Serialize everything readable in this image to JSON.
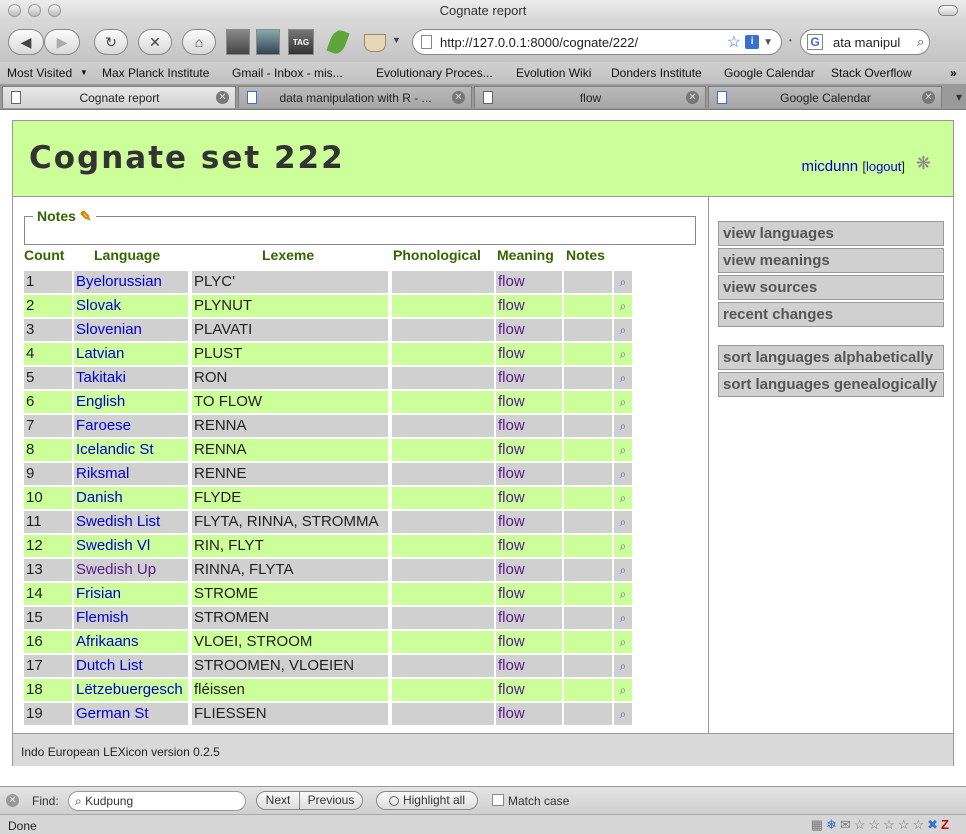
{
  "window": {
    "title": "Cognate report"
  },
  "toolbar": {
    "url": "http://127.0.0.1:8000/cognate/222/",
    "search_value": "ata manipul",
    "search_engine_glyph": "G",
    "tag_label": "TAG"
  },
  "bookmarks": [
    "Most Visited",
    "Max Planck Institute",
    "Gmail - Inbox - mis...",
    "Evolutionary Proces...",
    "Evolution Wiki",
    "Donders Institute",
    "Google Calendar",
    "Stack Overflow"
  ],
  "tabs": [
    {
      "label": "Cognate report",
      "active": true
    },
    {
      "label": "data manipulation with R - ...",
      "active": false
    },
    {
      "label": "flow",
      "active": false
    },
    {
      "label": "Google Calendar",
      "active": false
    }
  ],
  "header": {
    "title": "Cognate set 222",
    "username": "micdunn",
    "logout": "logout",
    "bracket_open": "[",
    "bracket_close": "]"
  },
  "notes": {
    "legend": "Notes"
  },
  "table": {
    "headers": {
      "count": "Count",
      "language": "Language",
      "lexeme": "Lexeme",
      "phonological": "Phonological",
      "meaning": "Meaning",
      "notes": "Notes"
    },
    "rows": [
      {
        "count": "1",
        "language": "Byelorussian",
        "lexeme": "PLYC'",
        "meaning": "flow",
        "shade": "odd"
      },
      {
        "count": "2",
        "language": "Slovak",
        "lexeme": "PLYNUT",
        "meaning": "flow",
        "shade": "even"
      },
      {
        "count": "3",
        "language": "Slovenian",
        "lexeme": "PLAVATI",
        "meaning": "flow",
        "shade": "odd"
      },
      {
        "count": "4",
        "language": "Latvian",
        "lexeme": "PLUST",
        "meaning": "flow",
        "shade": "even"
      },
      {
        "count": "5",
        "language": "Takitaki",
        "lexeme": "RON",
        "meaning": "flow",
        "shade": "odd"
      },
      {
        "count": "6",
        "language": "English",
        "lexeme": "TO FLOW",
        "meaning": "flow",
        "shade": "even"
      },
      {
        "count": "7",
        "language": "Faroese",
        "lexeme": "RENNA",
        "meaning": "flow",
        "shade": "odd"
      },
      {
        "count": "8",
        "language": "Icelandic St",
        "lexeme": "RENNA",
        "meaning": "flow",
        "shade": "even"
      },
      {
        "count": "9",
        "language": "Riksmal",
        "lexeme": "RENNE",
        "meaning": "flow",
        "shade": "odd"
      },
      {
        "count": "10",
        "language": "Danish",
        "lexeme": "FLYDE",
        "meaning": "flow",
        "shade": "even"
      },
      {
        "count": "11",
        "language": "Swedish List",
        "lexeme": "FLYTA, RINNA, STROMMA",
        "meaning": "flow",
        "shade": "odd"
      },
      {
        "count": "12",
        "language": "Swedish Vl",
        "lexeme": "RIN, FLYT",
        "meaning": "flow",
        "shade": "even"
      },
      {
        "count": "13",
        "language": "Swedish Up",
        "lexeme": "RINNA, FLYTA",
        "meaning": "flow",
        "shade": "odd",
        "visited": true
      },
      {
        "count": "14",
        "language": "Frisian",
        "lexeme": "STROME",
        "meaning": "flow",
        "shade": "even"
      },
      {
        "count": "15",
        "language": "Flemish",
        "lexeme": "STROMEN",
        "meaning": "flow",
        "shade": "odd"
      },
      {
        "count": "16",
        "language": "Afrikaans",
        "lexeme": "VLOEI, STROOM",
        "meaning": "flow",
        "shade": "even"
      },
      {
        "count": "17",
        "language": "Dutch List",
        "lexeme": "STROOMEN, VLOEIEN",
        "meaning": "flow",
        "shade": "odd"
      },
      {
        "count": "18",
        "language": "Lëtzebuergesch",
        "lexeme": "fléissen",
        "meaning": "flow",
        "shade": "even"
      },
      {
        "count": "19",
        "language": "German St",
        "lexeme": "FLIESSEN",
        "meaning": "flow",
        "shade": "odd"
      }
    ]
  },
  "sidebar": {
    "nav": [
      "view languages",
      "view meanings",
      "view sources",
      "recent changes"
    ],
    "sort": [
      "sort languages alphabetically",
      "sort languages genealogically"
    ]
  },
  "footer": {
    "text": "Indo European LEXicon version 0.2.5"
  },
  "findbar": {
    "label": "Find:",
    "value": "Kudpung",
    "next": "Next",
    "previous": "Previous",
    "highlight": "Highlight all",
    "match_case": "Match case"
  },
  "status": {
    "text": "Done"
  },
  "colors": {
    "header_bg": "#ccff99",
    "row_odd": "#d0d0d0",
    "row_even": "#ccff99",
    "link": "#0000cc",
    "visited": "#551a8b",
    "heading_green": "#336600"
  }
}
